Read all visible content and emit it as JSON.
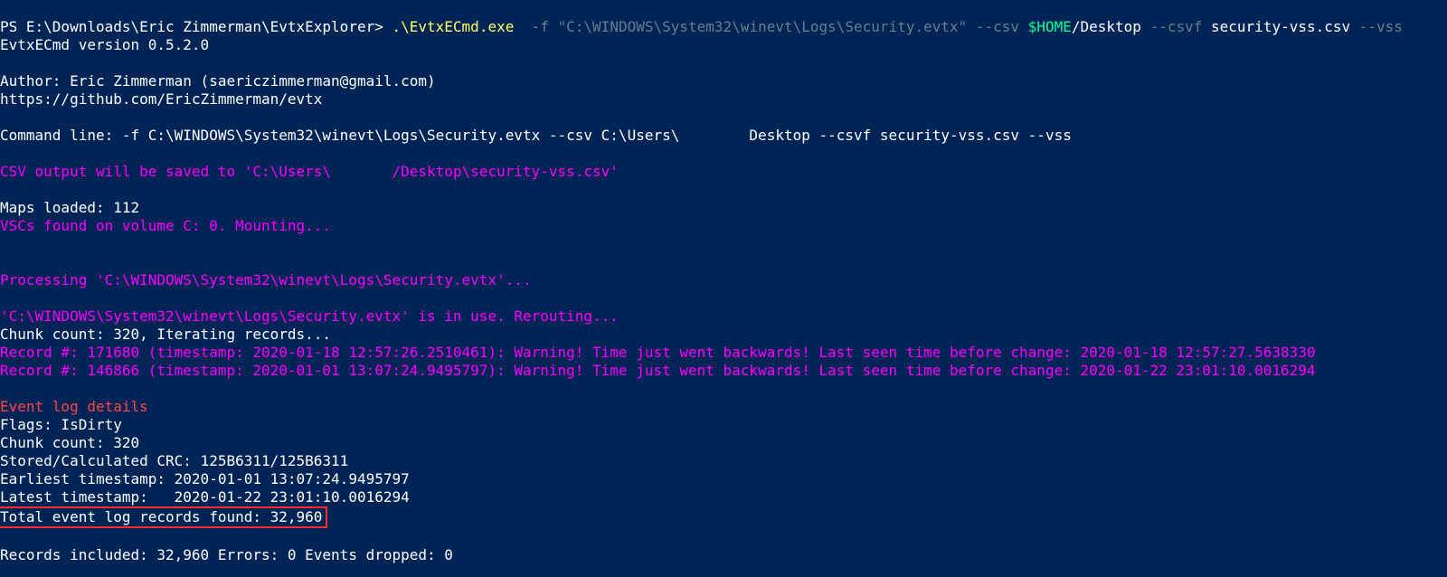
{
  "prompt": {
    "prefix": "PS E:\\Downloads\\Eric Zimmerman\\EvtxExplorer> ",
    "exe": ".\\EvtxECmd.exe  ",
    "flag_f": "-f ",
    "path_arg": "\"C:\\WINDOWS\\System32\\winevt\\Logs\\Security.evtx\"",
    "csv_flag": " --csv ",
    "home_var": "$HOME",
    "desktop": "/Desktop ",
    "csvf_flag": "--csvf ",
    "csvf_name": "security-vss.csv ",
    "vss_flag": "--vss"
  },
  "version_line": "EvtxECmd version 0.5.2.0",
  "author_line": "Author: Eric Zimmerman (saericzimmerman@gmail.com)",
  "github_line": "https://github.com/EricZimmerman/evtx",
  "cmdline": "Command line: -f C:\\WINDOWS\\System32\\winevt\\Logs\\Security.evtx --csv C:\\Users\\        Desktop --csvf security-vss.csv --vss",
  "csv_out": "CSV output will be saved to 'C:\\Users\\       /Desktop\\security-vss.csv'",
  "maps_line": "Maps loaded: 112",
  "vsc_line": "VSCs found on volume C: 0. Mounting...",
  "processing": "Processing 'C:\\WINDOWS\\System32\\winevt\\Logs\\Security.evtx'...",
  "inuse": "'C:\\WINDOWS\\System32\\winevt\\Logs\\Security.evtx' is in use. Rerouting...",
  "chunk_iter": "Chunk count: 320, Iterating records...",
  "record1": "Record #: 171680 (timestamp: 2020-01-18 12:57:26.2510461): Warning! Time just went backwards! Last seen time before change: 2020-01-18 12:57:27.5638330",
  "record2": "Record #: 146866 (timestamp: 2020-01-01 13:07:24.9495797): Warning! Time just went backwards! Last seen time before change: 2020-01-22 23:01:10.0016294",
  "details_header": "Event log details",
  "flags": "Flags: IsDirty",
  "chunk_count": "Chunk count: 320",
  "crc": "Stored/Calculated CRC: 125B6311/125B6311",
  "earliest": "Earliest timestamp: 2020-01-01 13:07:24.9495797",
  "latest": "Latest timestamp:   2020-01-22 23:01:10.0016294",
  "total_found": "Total event log records found: 32,960",
  "summary": "Records included: 32,960 Errors: 0 Events dropped: 0"
}
